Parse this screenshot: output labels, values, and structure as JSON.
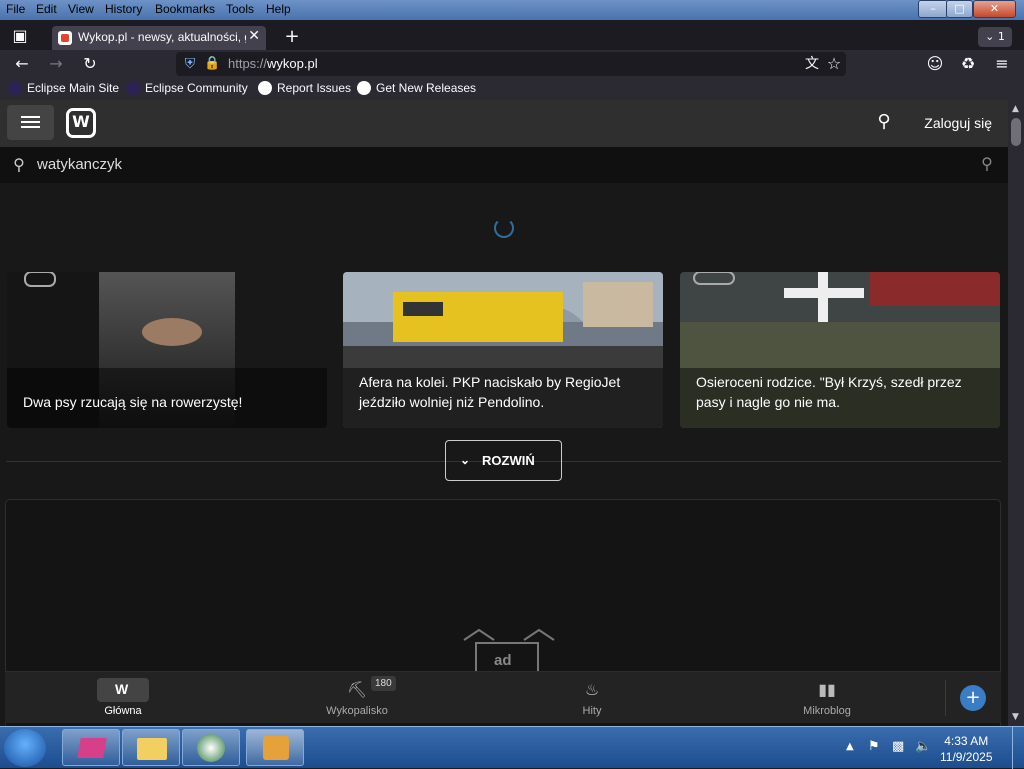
{
  "menus": [
    "File",
    "Edit",
    "View",
    "History",
    "Bookmarks",
    "Tools",
    "Help"
  ],
  "tab": {
    "title": "Wykop.pl - newsy, aktualności, g",
    "count": "1"
  },
  "address": {
    "protocol": "https://",
    "host": "wykop.pl"
  },
  "bookmarks": [
    "Eclipse Main Site",
    "Eclipse Community",
    "Report Issues",
    "Get New Releases"
  ],
  "site": {
    "login": "Zaloguj się",
    "search_query": "watykanczyk",
    "logo_letter": "W"
  },
  "cards": [
    {
      "caption": "Dwa psy rzucają się na rowerzystę!"
    },
    {
      "caption": "Afera na kolei. PKP naciskało by RegioJet jeździło wolniej niż Pendolino."
    },
    {
      "caption": "Osieroceni rodzice. \"Był Krzyś, szedł przez pasy i nagle go nie ma."
    }
  ],
  "expand_button": "ROZWIŃ",
  "ad_label": "ad",
  "bottom_nav": [
    {
      "label": "Główna",
      "active": true
    },
    {
      "label": "Wykopalisko",
      "badge": "180"
    },
    {
      "label": "Hity"
    },
    {
      "label": "Mikroblog"
    }
  ],
  "taskbar": {
    "time": "4:33 AM",
    "date": "11/9/2025"
  }
}
